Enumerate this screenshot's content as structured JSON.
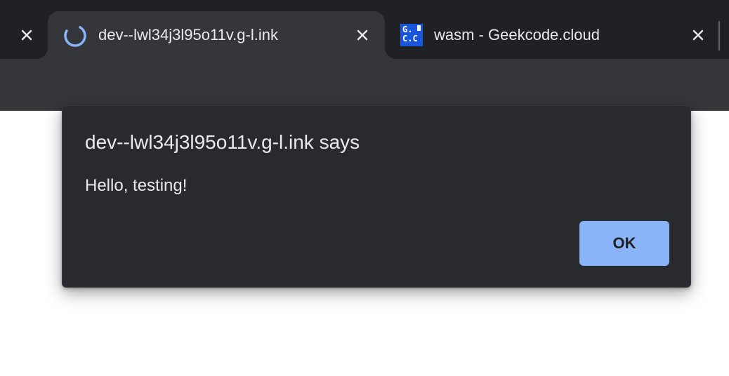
{
  "tabs": [
    {
      "title": "",
      "state": "inactive-partial"
    },
    {
      "title": "dev--lwl34j3l95o11v.g-l.ink",
      "state": "active",
      "icon": "loading-spinner-icon"
    },
    {
      "title": "wasm - Geekcode.cloud",
      "state": "inactive",
      "icon": "geekcode-favicon-icon",
      "favicon_text": "G.\nC.C"
    }
  ],
  "dialog": {
    "title": "dev--lwl34j3l95o11v.g-l.ink says",
    "message": "Hello, testing!",
    "ok_label": "OK"
  },
  "colors": {
    "tabstrip_bg": "#202124",
    "active_tab_bg": "#35363a",
    "dialog_bg": "#292a2d",
    "ok_button_bg": "#8ab4f8",
    "spinner": "#8ab4f8",
    "favicon_bg": "#1a56db"
  }
}
